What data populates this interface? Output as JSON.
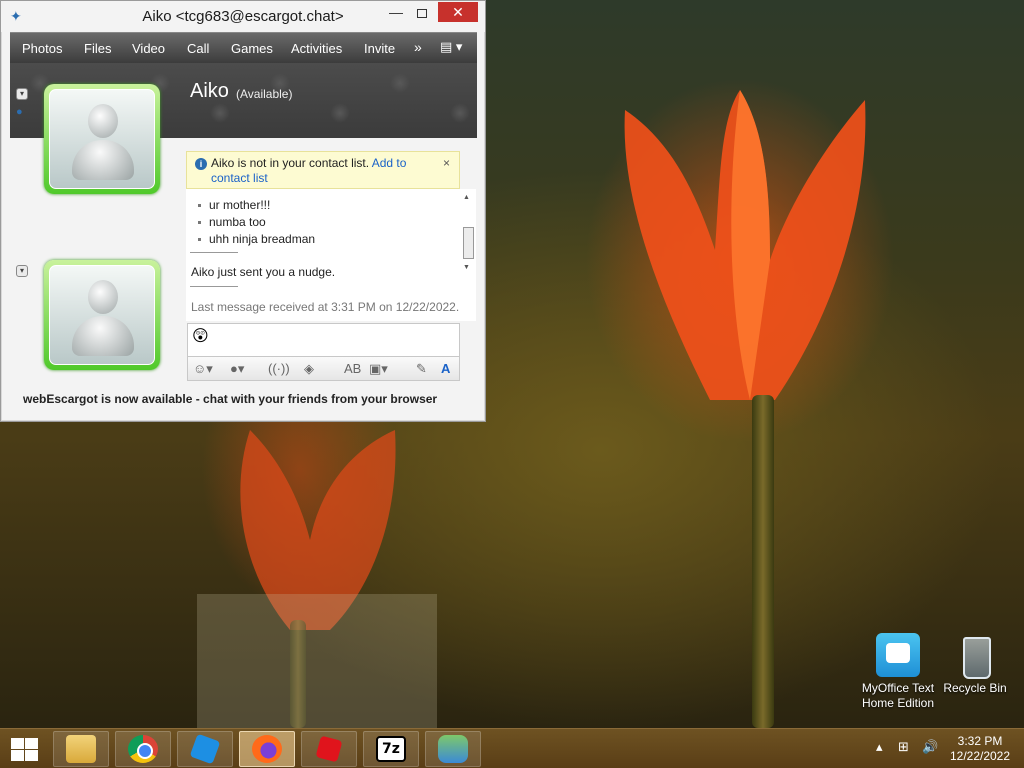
{
  "window": {
    "title": "Aiko <tcg683@escargot.chat>",
    "menu": [
      "Photos",
      "Files",
      "Video",
      "Call",
      "Games",
      "Activities",
      "Invite"
    ],
    "menu_more": "»",
    "contact_name": "Aiko",
    "contact_status": "(Available)",
    "infobar": {
      "text": "Aiko is not in your contact list.",
      "link": "Add to contact list",
      "close": "×"
    },
    "messages": [
      "ur mother!!!",
      "numba too",
      "uhh ninja breadman"
    ],
    "nudge_text": "Aiko just sent you a nudge.",
    "last_message": "Last message received at 3:31 PM on 12/22/2022.",
    "input_emoji": "😲",
    "status_line": "webEscargot is now available - chat with your friends from your browser"
  },
  "desktop": {
    "icons": [
      {
        "label_line1": "MyOffice Text",
        "label_line2": "Home Edition"
      },
      {
        "label_line1": "Recycle Bin",
        "label_line2": ""
      }
    ]
  },
  "taskbar": {
    "apps": [
      "file-explorer",
      "google-chrome",
      "roblox-studio",
      "firefox",
      "roblox",
      "7-zip",
      "escargot-messenger"
    ],
    "seven_zip_label": "7z",
    "time": "3:32 PM",
    "date": "12/22/2022"
  },
  "colors": {
    "accent_close": "#c7312c",
    "link": "#1a62c8",
    "avatar_frame": "#4fc92a",
    "taskbar": "#5a3e16"
  }
}
